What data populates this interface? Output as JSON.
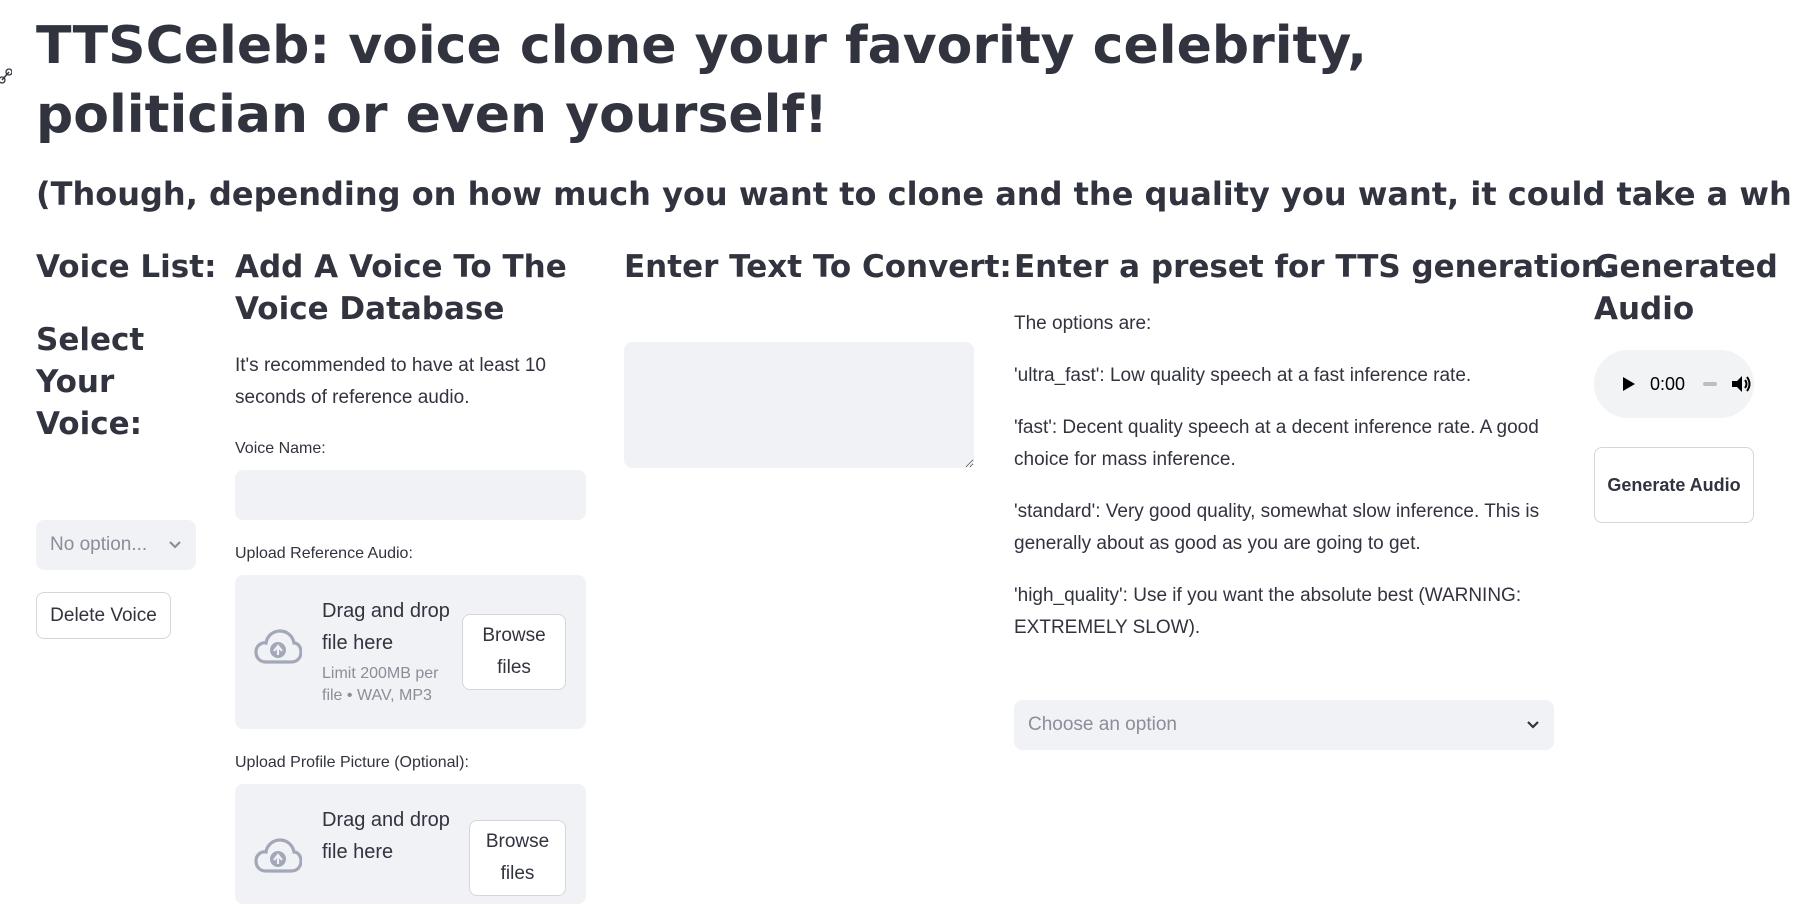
{
  "page": {
    "title": "TTSCeleb: voice clone your favority celebrity, politician or even yourself!",
    "subtitle": "(Though, depending on how much you want to clone and the quality you want, it could take a while.)"
  },
  "voice_list": {
    "heading": "Voice List:",
    "select_heading": "Select Your Voice:",
    "select_placeholder": "No option...",
    "delete_button": "Delete Voice"
  },
  "add_voice": {
    "heading": "Add A Voice To The Voice Database",
    "description": "It's recommended to have at least 10 seconds of reference audio.",
    "voice_name_label": "Voice Name:",
    "voice_name_value": "",
    "upload_audio_label": "Upload Reference Audio:",
    "upload_audio": {
      "drag_text": "Drag and drop file here",
      "limit_text": "Limit 200MB per file • WAV, MP3",
      "browse_button": "Browse files"
    },
    "upload_picture_label": "Upload Profile Picture (Optional):",
    "upload_picture": {
      "drag_text": "Drag and drop file here",
      "browse_button": "Browse files"
    }
  },
  "text_input": {
    "heading": "Enter Text To Convert:",
    "value": ""
  },
  "preset": {
    "heading": "Enter a preset for TTS generation.",
    "intro": "The options are:",
    "options_text": [
      "'ultra_fast': Low quality speech at a fast inference rate.",
      "'fast': Decent quality speech at a decent inference rate. A good choice for mass inference.",
      "'standard': Very good quality, somewhat slow inference. This is generally about as good as you are going to get.",
      "'high_quality': Use if you want the absolute best (WARNING: EXTREMELY SLOW)."
    ],
    "select_placeholder": "Choose an option"
  },
  "generated": {
    "heading": "Generated Audio",
    "audio_time": "0:00",
    "generate_button": "Generate Audio"
  },
  "icons": {
    "upload": "cloud-upload-icon",
    "chevron": "chevron-down-icon",
    "play": "play-icon",
    "volume": "volume-icon"
  },
  "colors": {
    "text": "#31333f",
    "field_bg": "#f0f2f6",
    "placeholder": "#8b8d98",
    "upload_icon": "#a3a8b8"
  }
}
